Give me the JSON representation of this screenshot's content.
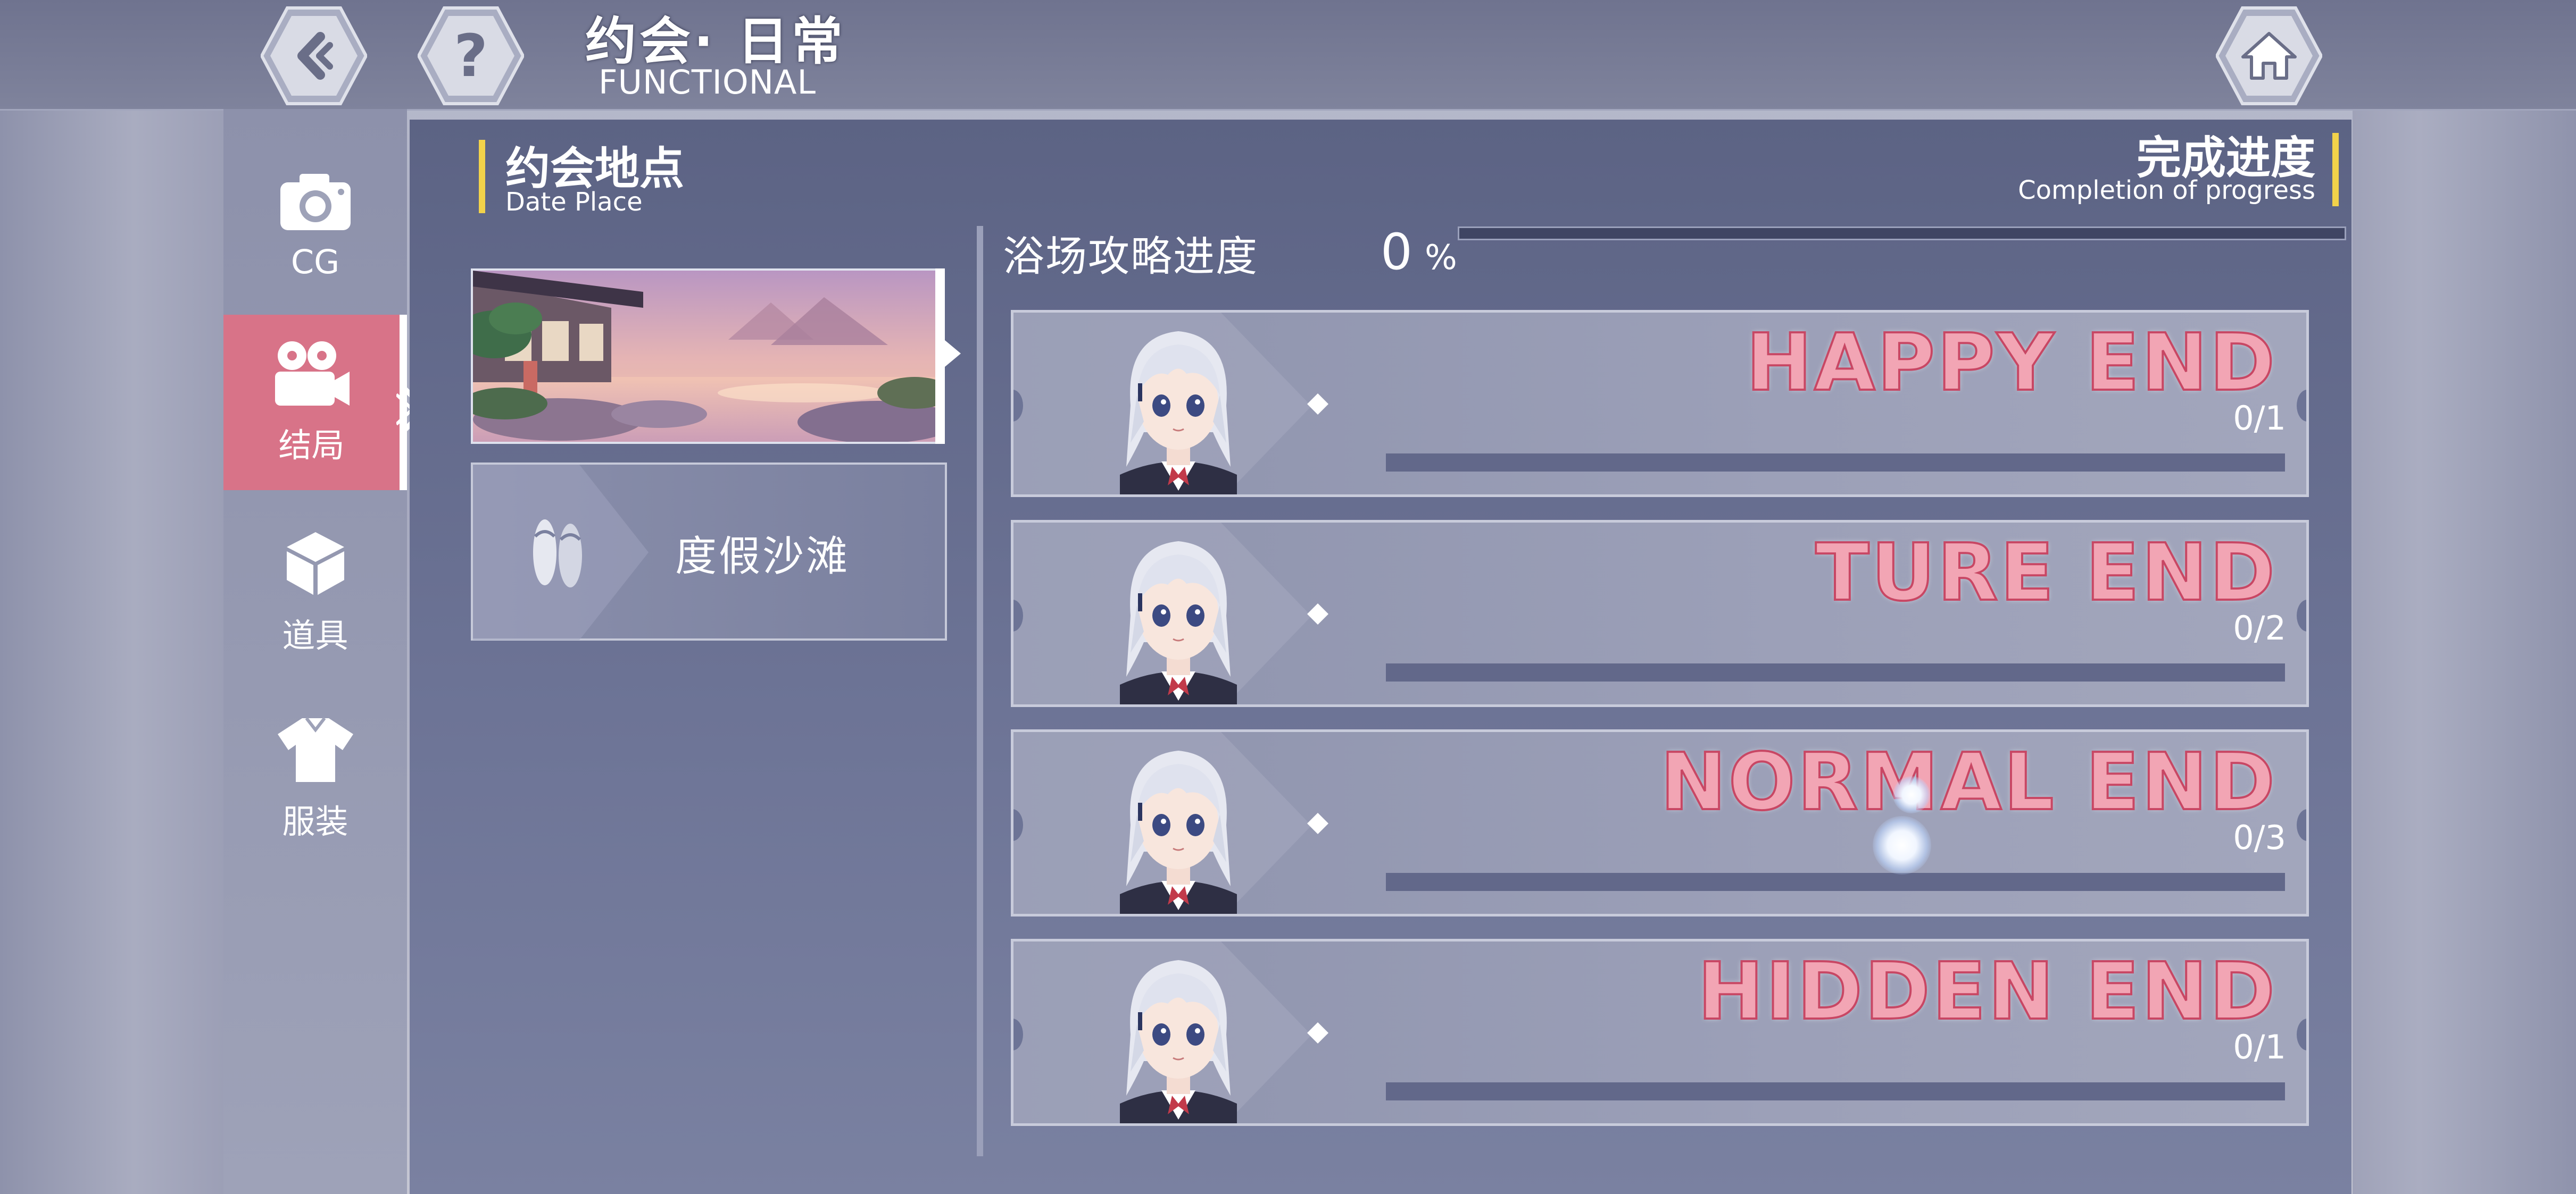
{
  "header": {
    "back_icon": "back-arrow-icon",
    "help_icon": "question-mark-icon",
    "title": "约会· 日常",
    "subtitle": "FUNCTIONAL",
    "home_icon": "home-icon"
  },
  "sidebar": {
    "items": [
      {
        "label": "CG",
        "icon": "camera-icon",
        "active": false
      },
      {
        "label": "结局",
        "icon": "video-camera-icon",
        "active": true
      },
      {
        "label": "道具",
        "icon": "cube-icon",
        "active": false
      },
      {
        "label": "服装",
        "icon": "shirt-icon",
        "active": false
      }
    ]
  },
  "section": {
    "title": "约会地点",
    "subtitle": "Date Place"
  },
  "progress_header": {
    "title": "完成进度",
    "subtitle": "Completion of progress"
  },
  "places": [
    {
      "type": "image",
      "selected": true
    },
    {
      "label": "度假沙滩",
      "icon": "sandals-icon",
      "selected": false
    }
  ],
  "place_progress": {
    "label": "浴场攻略进度",
    "value": "0",
    "unit": "%",
    "fraction": 0
  },
  "endings": [
    {
      "label": "HAPPY END",
      "count": "0/1",
      "progress": 0
    },
    {
      "label": "TURE END",
      "count": "0/2",
      "progress": 0
    },
    {
      "label": "NORMAL END",
      "count": "0/3",
      "progress": 0
    },
    {
      "label": "HIDDEN END",
      "count": "0/1",
      "progress": 0
    }
  ],
  "colors": {
    "accent_pink": "#d87388",
    "yellow_marker": "#f2d24a",
    "end_label": "#f2a5b4"
  }
}
